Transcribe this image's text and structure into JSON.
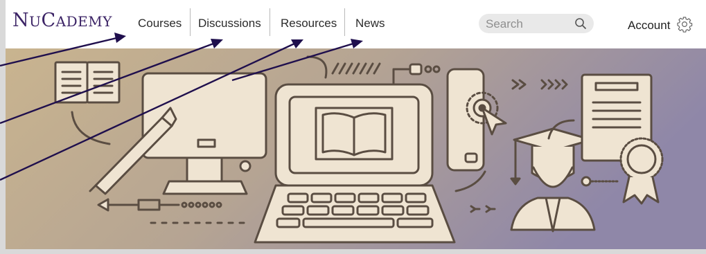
{
  "logo": {
    "first": "N",
    "first_sc": "U",
    "second": "C",
    "second_sc": "ADEMY"
  },
  "nav": {
    "items": [
      {
        "label": "Courses"
      },
      {
        "label": "Discussions"
      },
      {
        "label": "Resources"
      },
      {
        "label": "News"
      }
    ]
  },
  "search": {
    "placeholder": "Search",
    "icon": "search-icon"
  },
  "account": {
    "label": "Account",
    "settings_icon": "gear-icon"
  },
  "banner": {
    "description": "e-learning illustration",
    "colors": {
      "left": "#c9b48f",
      "right": "#8f87a8",
      "line": "#5a4d42",
      "fill": "#efe4d2"
    }
  },
  "colors": {
    "brand": "#3c2466",
    "arrow": "#1f0f4d"
  }
}
